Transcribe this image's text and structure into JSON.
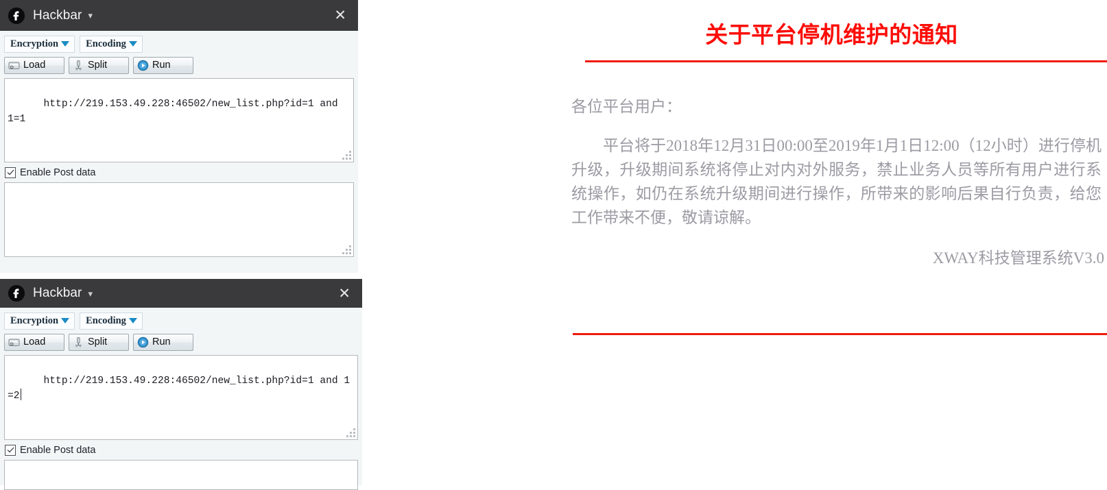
{
  "panels": [
    {
      "title": "Hackbar",
      "logo_icon": "hackbar-logo-icon",
      "caret_icon": "chevron-down-icon",
      "close_icon": "close-icon",
      "dropdowns": [
        {
          "label": "Encryption"
        },
        {
          "label": "Encoding"
        }
      ],
      "actions": [
        {
          "label": "Load",
          "icon": "load-icon"
        },
        {
          "label": "Split",
          "icon": "split-icon"
        },
        {
          "label": "Run",
          "icon": "run-play-icon"
        }
      ],
      "url_value": "http://219.153.49.228:46502/new_list.php?id=1 and 1=1",
      "post_checkbox_label": "Enable Post data",
      "post_checkbox_checked": "checked",
      "post_value": ""
    },
    {
      "title": "Hackbar",
      "logo_icon": "hackbar-logo-icon",
      "caret_icon": "chevron-down-icon",
      "close_icon": "close-icon",
      "dropdowns": [
        {
          "label": "Encryption"
        },
        {
          "label": "Encoding"
        }
      ],
      "actions": [
        {
          "label": "Load",
          "icon": "load-icon"
        },
        {
          "label": "Split",
          "icon": "split-icon"
        },
        {
          "label": "Run",
          "icon": "run-play-icon"
        }
      ],
      "url_value": "http://219.153.49.228:46502/new_list.php?id=1 and 1=2",
      "post_checkbox_label": "Enable Post data",
      "post_checkbox_checked": "checked",
      "post_value": ""
    }
  ],
  "notice": {
    "title": "关于平台停机维护的通知",
    "salutation": "各位平台用户：",
    "paragraph": "平台将于2018年12月31日00:00至2019年1月1日12:00（12小时）进行停机升级，升级期间系统将停止对内对外服务，禁止业务人员等所有用户进行系统操作，如仍在系统升级期间进行操作，所带来的影响后果自行负责，给您工作带来不便，敬请谅解。",
    "signature": "XWAY科技管理系统V3.0"
  },
  "colors": {
    "title_red": "#fc0d08",
    "rule_red": "#ef1b0a",
    "titlebar_dark": "#3a3a3c",
    "body_gray": "#9b9ba3",
    "accent_blue": "#1a8bc4"
  }
}
